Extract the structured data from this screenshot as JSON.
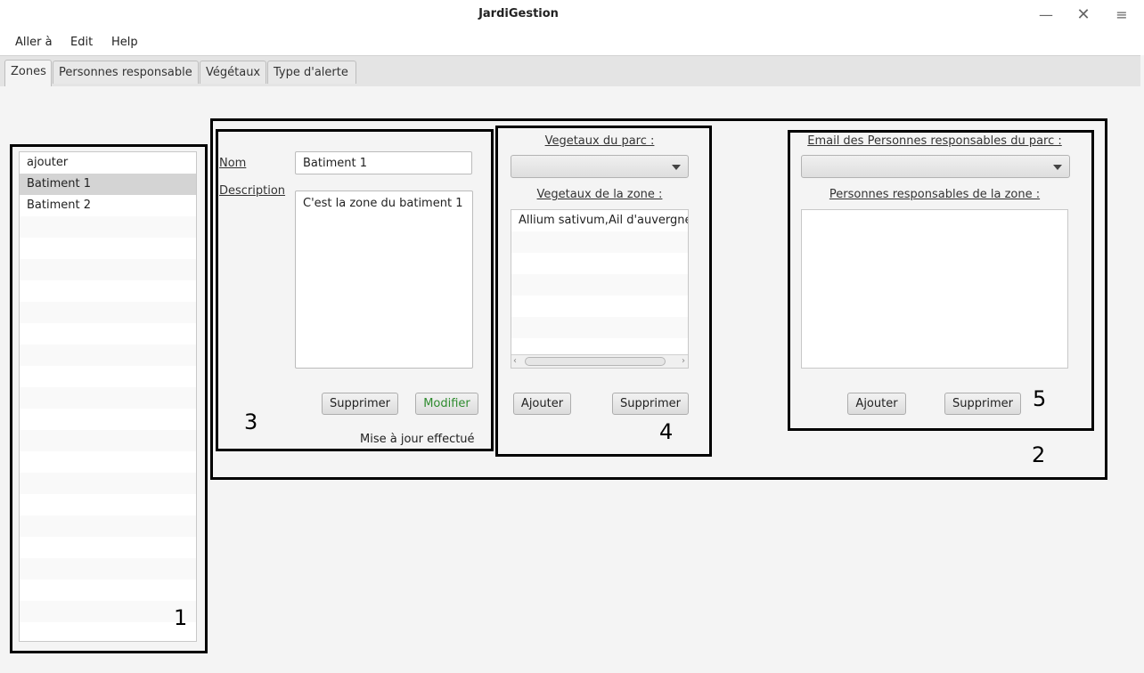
{
  "window": {
    "title": "JardiGestion"
  },
  "menus": [
    "Aller à",
    "Edit",
    "Help"
  ],
  "tabs": [
    "Zones",
    "Personnes responsable",
    "Végétaux",
    "Type d'alerte"
  ],
  "zone_list": {
    "items": [
      "ajouter",
      "Batiment 1",
      "Batiment 2"
    ],
    "selected": "Batiment 1"
  },
  "zone_form": {
    "nom_label": "Nom",
    "nom_value": "Batiment 1",
    "description_label": "Description",
    "description_value": "C'est la zone du batiment 1",
    "delete_button": "Supprimer",
    "modify_button": "Modifier",
    "status": "Mise à jour effectué"
  },
  "vegetaux": {
    "park_label": "Vegetaux du parc :",
    "zone_label": "Vegetaux de la zone :",
    "zone_items": [
      "Allium sativum,Ail d'auvergne"
    ],
    "add_button": "Ajouter",
    "delete_button": "Supprimer"
  },
  "personnes": {
    "email_label": "Email des Personnes responsables du parc :",
    "zone_label": "Personnes responsables de la zone :",
    "add_button": "Ajouter",
    "delete_button": "Supprimer"
  },
  "annotations": [
    "1",
    "2",
    "3",
    "4",
    "5"
  ],
  "colors": {
    "modify_text": "#2e8b2e",
    "selected_row": "#d4d4d4",
    "annotation_border": "#000000"
  }
}
